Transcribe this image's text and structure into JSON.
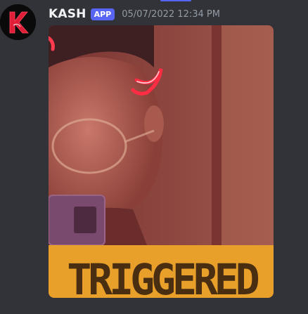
{
  "message": {
    "author": {
      "name": "KASH",
      "badge": "APP",
      "avatar_icon": "kash-k-logo-icon",
      "avatar_colors": {
        "background": "#0a0a0a",
        "letter": "#e01e37"
      }
    },
    "timestamp": "05/07/2022 12:34 PM"
  },
  "attachment": {
    "caption": "TRIGGERED",
    "colors": {
      "banner": "#e8a02a",
      "caption_text": "#3a2210",
      "tint": "#8a3a34"
    }
  },
  "theme": {
    "background": "#313338",
    "accent": "#5865f2",
    "username": "#f2f3f5",
    "timestamp": "#949ba4"
  }
}
